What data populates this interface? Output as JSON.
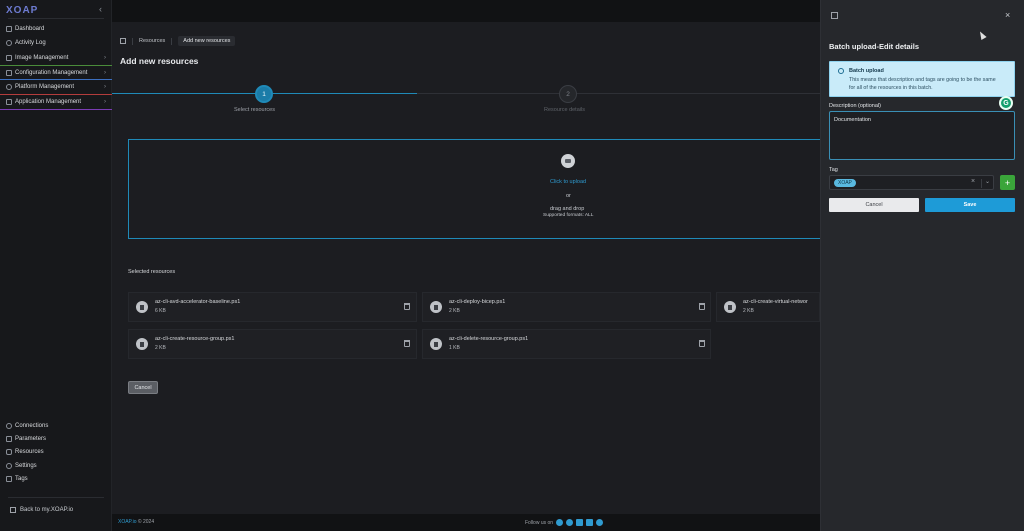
{
  "app": {
    "logo": "XOAP"
  },
  "sidebar": {
    "items": [
      {
        "label": "Dashboard",
        "icon": "dashboard-icon"
      },
      {
        "label": "Activity Log",
        "icon": "activity-icon"
      },
      {
        "label": "Image Management",
        "icon": "image-icon"
      },
      {
        "label": "Configuration Management",
        "icon": "config-icon"
      },
      {
        "label": "Platform Management",
        "icon": "platform-icon"
      },
      {
        "label": "Application Management",
        "icon": "application-icon"
      }
    ],
    "bottom_items": [
      {
        "label": "Connections",
        "icon": "link-icon"
      },
      {
        "label": "Parameters",
        "icon": "list-icon"
      },
      {
        "label": "Resources",
        "icon": "database-icon"
      },
      {
        "label": "Settings",
        "icon": "gear-icon"
      },
      {
        "label": "Tags",
        "icon": "tag-icon"
      }
    ],
    "back_link": "Back to my.XOAP.io"
  },
  "breadcrumb": {
    "root": "Resources",
    "current": "Add new resources"
  },
  "page": {
    "title": "Add new resources"
  },
  "stepper": {
    "steps": [
      {
        "number": "1",
        "label": "Select resources"
      },
      {
        "number": "2",
        "label": "Resource details"
      }
    ]
  },
  "dropzone": {
    "click_label": "Click to upload",
    "or": "or",
    "dnd": "drag and drop",
    "formats": "Supported formats: ALL"
  },
  "selected": {
    "title": "Selected resources",
    "files": [
      {
        "name": "az-cli-avd-accelerator-baseline.ps1",
        "size": "6 KB"
      },
      {
        "name": "az-cli-deploy-bicep.ps1",
        "size": "2 KB"
      },
      {
        "name": "az-cli-create-virtual-networ",
        "size": "2 KB"
      },
      {
        "name": "az-cli-create-resource-group.ps1",
        "size": "2 KB"
      },
      {
        "name": "az-cli-delete-resource-group.ps1",
        "size": "1 KB"
      }
    ]
  },
  "main_cancel": "Cancel",
  "footer": {
    "brand": "XOAP.io",
    "copyright": "© 2024",
    "follow": "Follow us on"
  },
  "panel": {
    "title": "Batch upload-Edit details",
    "info_title": "Batch upload",
    "info_text": "This means that description and tags are going to be the same for all of the resources in this batch.",
    "description_label": "Description (optional)",
    "description_value": "Documentation",
    "tag_label": "Tag",
    "tag_value": "XOAP",
    "add_tag": "+",
    "cancel": "Cancel",
    "save": "Save"
  },
  "colors": {
    "accent": "#1e9bd7",
    "add_button": "#3aa53a",
    "info_bg": "#c9ebf9"
  }
}
